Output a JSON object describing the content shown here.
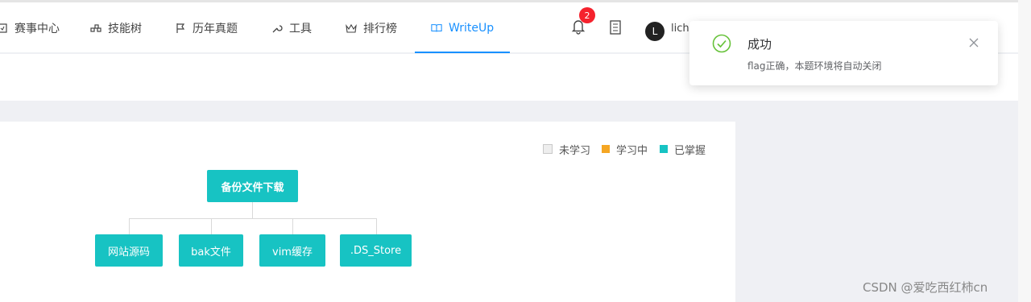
{
  "nav": {
    "items": [
      {
        "label": "赛事中心",
        "icon": "trophy-icon"
      },
      {
        "label": "技能树",
        "icon": "nodes-icon"
      },
      {
        "label": "历年真题",
        "icon": "flag-icon"
      },
      {
        "label": "工具",
        "icon": "wrench-icon"
      },
      {
        "label": "排行榜",
        "icon": "crown-icon"
      },
      {
        "label": "WriteUp",
        "icon": "book-icon",
        "active": true
      }
    ],
    "notification_count": "2",
    "user": {
      "avatar_letter": "L",
      "name": "licha"
    }
  },
  "toast": {
    "title": "成功",
    "message": "flag正确，本题环境将自动关闭",
    "icon": "check-circle-icon"
  },
  "legend": [
    {
      "label": "未学习",
      "color": "#e8e8e8"
    },
    {
      "label": "学习中",
      "color": "#f5a623"
    },
    {
      "label": "已掌握",
      "color": "#17c3c3"
    }
  ],
  "tree": {
    "root": "备份文件下载",
    "children": [
      "网站源码",
      "bak文件",
      "vim缓存",
      ".DS_Store"
    ]
  },
  "watermark": "CSDN @爱吃西红柿cn",
  "colors": {
    "accent": "#1890ff",
    "node": "#17c3c3",
    "success": "#67c23a",
    "badge": "#f5222d"
  }
}
